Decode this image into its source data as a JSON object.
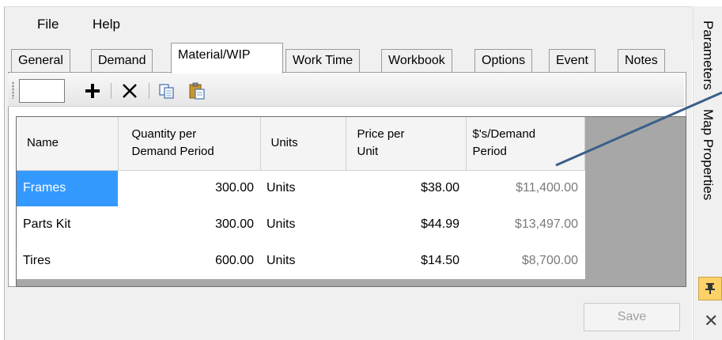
{
  "menu": {
    "file": "File",
    "help": "Help"
  },
  "tabs": [
    {
      "label": "General"
    },
    {
      "label": "Demand"
    },
    {
      "label": "Material/WIP",
      "active": true
    },
    {
      "label": "Work Time"
    },
    {
      "label": "Workbook"
    },
    {
      "label": "Options"
    },
    {
      "label": "Event"
    },
    {
      "label": "Notes"
    }
  ],
  "toolbar": {
    "icons": [
      "add-icon",
      "delete-icon",
      "copy-icon",
      "paste-icon"
    ]
  },
  "grid": {
    "headers": {
      "name": "Name",
      "quantity_line1": "Quantity per",
      "quantity_line2": "Demand Period",
      "units": "Units",
      "price_line1": "Price per",
      "price_line2": "Unit",
      "dollars_line1": "$'s/Demand",
      "dollars_line2": "Period"
    },
    "rows": [
      {
        "name": "Frames",
        "quantity": "300.00",
        "units": "Units",
        "price": "$38.00",
        "dollars": "$11,400.00"
      },
      {
        "name": "Parts Kit",
        "quantity": "300.00",
        "units": "Units",
        "price": "$44.99",
        "dollars": "$13,497.00"
      },
      {
        "name": "Tires",
        "quantity": "600.00",
        "units": "Units",
        "price": "$14.50",
        "dollars": "$8,700.00"
      }
    ]
  },
  "buttons": {
    "save": "Save"
  },
  "side_panel": {
    "parameters": "Parameters",
    "map_properties": "Map Properties"
  },
  "colors": {
    "selection": "#3399ff",
    "pin": "#fbd168",
    "arrow": "#3b5f8a"
  }
}
